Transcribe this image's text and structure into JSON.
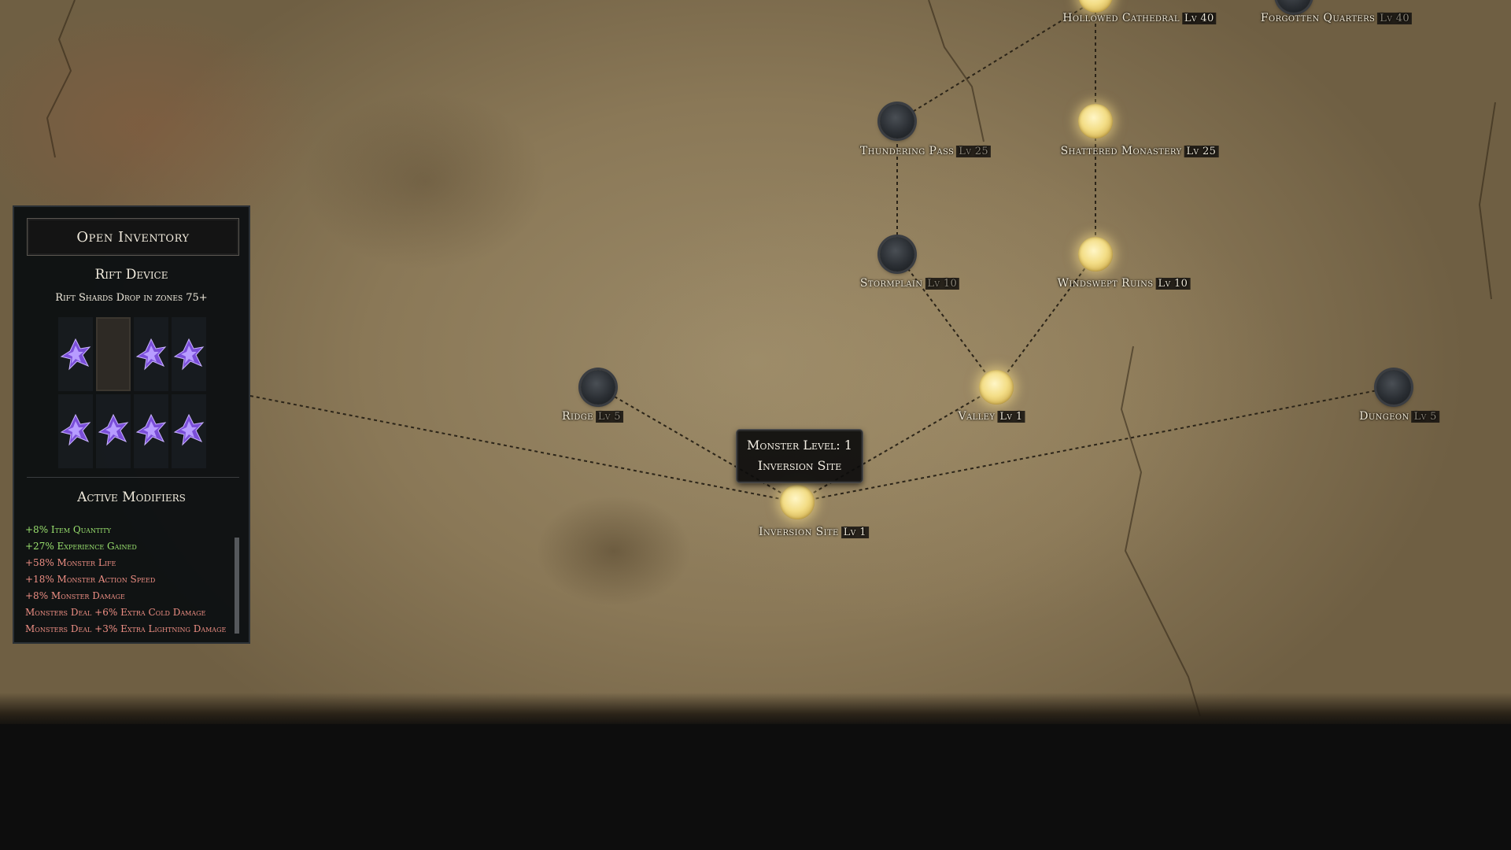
{
  "colors": {
    "active_node": "#f3dd86",
    "locked_node": "#2a2e33",
    "good_modifier": "#9be36f",
    "bad_modifier": "#ef8f84",
    "panel_bg": "#0d1012"
  },
  "map": {
    "nodes": [
      {
        "id": "hollowed-cathedral",
        "name": "Hollowed Cathedral",
        "level": "Lv 40",
        "state": "active"
      },
      {
        "id": "forgotten-quarters",
        "name": "Forgotten Quarters",
        "level": "Lv 40",
        "state": "locked"
      },
      {
        "id": "thundering-pass",
        "name": "Thundering Pass",
        "level": "Lv 25",
        "state": "locked"
      },
      {
        "id": "shattered-monastery",
        "name": "Shattered Monastery",
        "level": "Lv 25",
        "state": "active"
      },
      {
        "id": "stormplain",
        "name": "Stormplain",
        "level": "Lv 10",
        "state": "locked"
      },
      {
        "id": "windswept-ruins",
        "name": "Windswept Ruins",
        "level": "Lv 10",
        "state": "active"
      },
      {
        "id": "ridge",
        "name": "Ridge",
        "level": "Lv 5",
        "state": "locked"
      },
      {
        "id": "valley",
        "name": "Valley",
        "level": "Lv 1",
        "state": "active"
      },
      {
        "id": "dungeon",
        "name": "Dungeon",
        "level": "Lv 5",
        "state": "locked"
      },
      {
        "id": "inversion-site",
        "name": "Inversion Site",
        "level": "Lv 1",
        "state": "active"
      }
    ],
    "tooltip": {
      "line1": "Monster Level: 1",
      "line2": "Inversion Site"
    }
  },
  "panel": {
    "open_inventory": "Open Inventory",
    "title": "Rift Device",
    "subtitle": "Rift Shards Drop in zones 75+",
    "modifiers_title": "Active Modifiers",
    "modifiers": [
      {
        "text": "+8% Item Quantity",
        "type": "good"
      },
      {
        "text": "+27% Experience Gained",
        "type": "good"
      },
      {
        "text": "+58% Monster Life",
        "type": "bad"
      },
      {
        "text": "+18% Monster Action Speed",
        "type": "bad"
      },
      {
        "text": "+8% Monster Damage",
        "type": "bad"
      },
      {
        "text": "Monsters Deal +6% Extra Cold Damage",
        "type": "bad"
      },
      {
        "text": "Monsters Deal +3% Extra Lightning Damage",
        "type": "bad"
      }
    ],
    "shards": {
      "filled": 7,
      "total": 8,
      "icon": "rift-shard-icon"
    }
  }
}
